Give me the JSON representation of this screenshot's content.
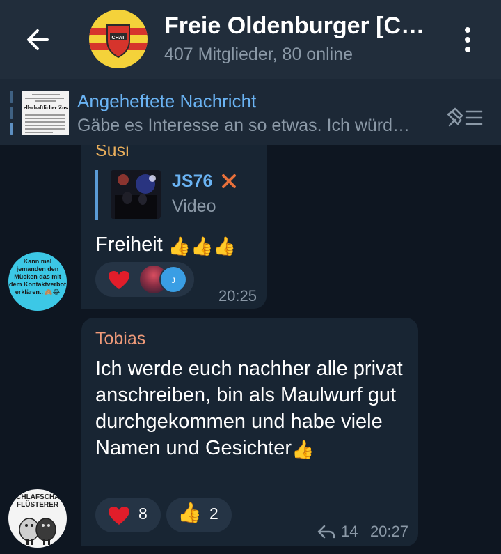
{
  "header": {
    "back_icon": "arrow-left-icon",
    "title": "Freie Oldenburger [Ch…",
    "subtitle": "407 Mitglieder, 80 online",
    "avatar_badge": "CHAT",
    "menu_icon": "more-vertical-icon"
  },
  "pinned": {
    "label": "Angeheftete Nachricht",
    "preview": "Gäbe es Interesse an so etwas. Ich würd…",
    "thumb_heading": "ellschaftlicher Zusammen",
    "list_icon": "pinned-list-icon"
  },
  "messages": [
    {
      "sender": "Susi",
      "reply": {
        "name": "JS76",
        "badge_icon": "cross-icon",
        "kind": "Video"
      },
      "text": "Freiheit",
      "emoji": "👍👍👍",
      "reactions": [
        {
          "icon": "heart-icon",
          "avatars": [
            "",
            "J"
          ]
        }
      ],
      "time": "20:25",
      "avatar_text": "Kann mal jemanden den Mücken das mit dem Kontaktverbot erklären.. 🙈😂"
    },
    {
      "sender": "Tobias",
      "text": "Ich werde euch nachher alle privat anschreiben, bin als Maulwurf gut durchgekommen und habe viele Namen und Gesichter",
      "emoji": "👍",
      "reactions": [
        {
          "icon": "heart-icon",
          "count": "8"
        },
        {
          "icon": "thumbs-up-icon",
          "emoji": "👍",
          "count": "2"
        }
      ],
      "forwards": "14",
      "time": "20:27",
      "avatar_text": "SCHLAFSCHAF FLÜSTERER"
    }
  ],
  "colors": {
    "background": "#0e1621",
    "header": "#212d3b",
    "bubble": "#182533",
    "accent": "#6ab3f3",
    "susi_name": "#e7ad5b",
    "tobias_name": "#f09b7a",
    "heart": "#e11d2a"
  }
}
